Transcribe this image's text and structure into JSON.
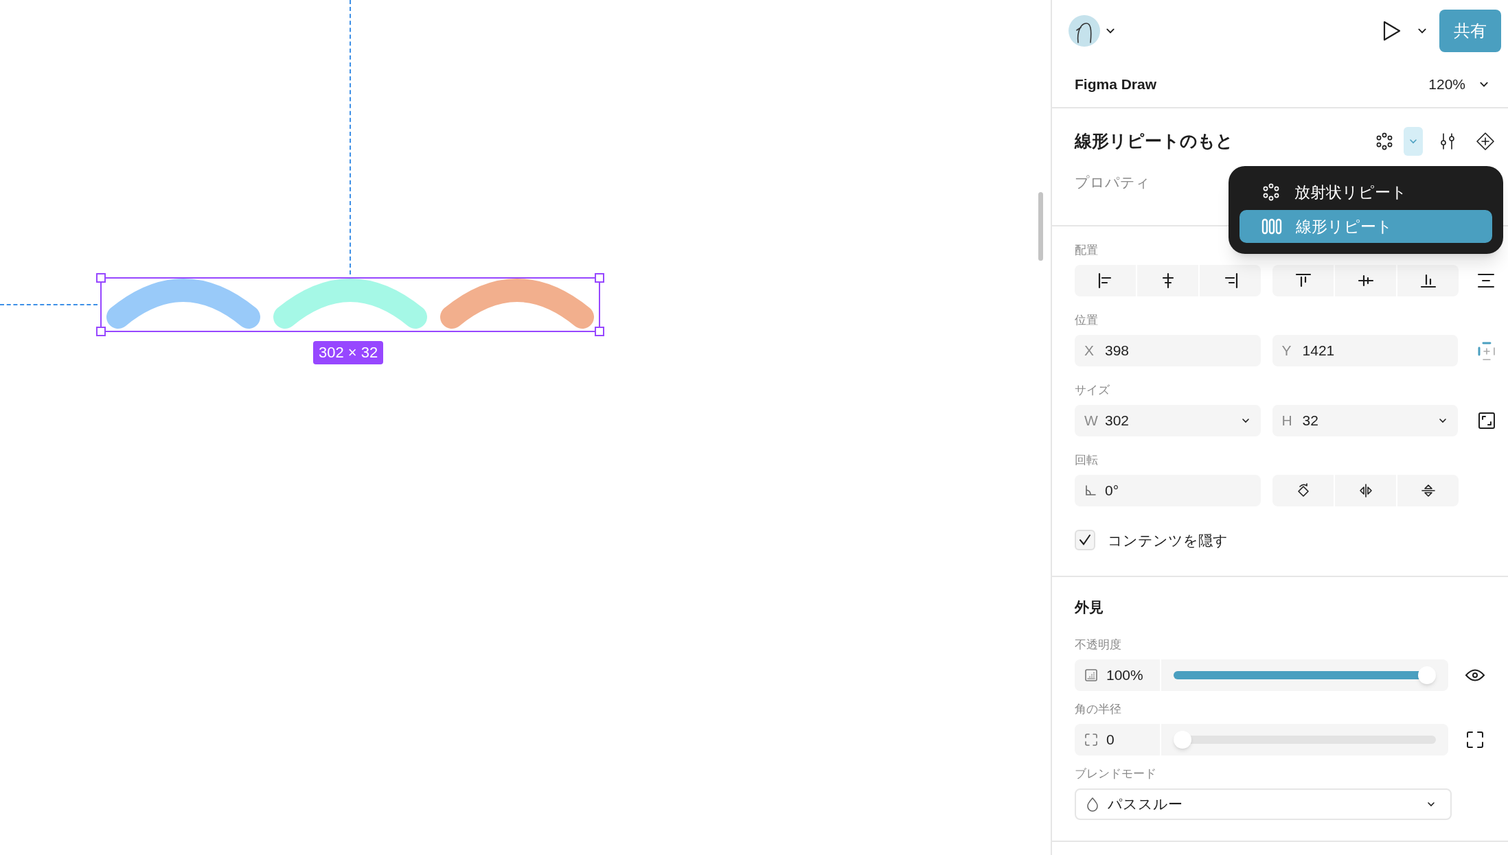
{
  "canvas": {
    "size_label": "302 × 32",
    "shapes": [
      {
        "color": "#99caf9"
      },
      {
        "color": "#a5f8e6"
      },
      {
        "color": "#f2af8d"
      }
    ]
  },
  "header": {
    "share_button": "共有",
    "file_name": "Figma Draw",
    "zoom": "120%"
  },
  "layer": {
    "title": "線形リピートのもと",
    "properties_label": "プロパティ"
  },
  "repeat_menu": {
    "items": [
      {
        "label": "放射状リピート",
        "kind": "radial",
        "selected": false
      },
      {
        "label": "線形リピート",
        "kind": "linear",
        "selected": true
      }
    ]
  },
  "alignment": {
    "label": "配置"
  },
  "position": {
    "label": "位置",
    "fields": [
      {
        "prefix": "X",
        "value": "398"
      },
      {
        "prefix": "Y",
        "value": "1421"
      }
    ]
  },
  "size": {
    "label": "サイズ",
    "fields": [
      {
        "prefix": "W",
        "value": "302"
      },
      {
        "prefix": "H",
        "value": "32"
      }
    ]
  },
  "rotation": {
    "label": "回転",
    "value": "0°"
  },
  "clip_content": {
    "label": "コンテンツを隠す",
    "checked": true
  },
  "appearance": {
    "title": "外見",
    "opacity": {
      "label": "不透明度",
      "value": "100%",
      "level": 1
    },
    "corner_radius": {
      "label": "角の半径",
      "value": "0",
      "level": 0
    },
    "blend_mode": {
      "label": "ブレンドモード",
      "value": "パススルー"
    }
  }
}
